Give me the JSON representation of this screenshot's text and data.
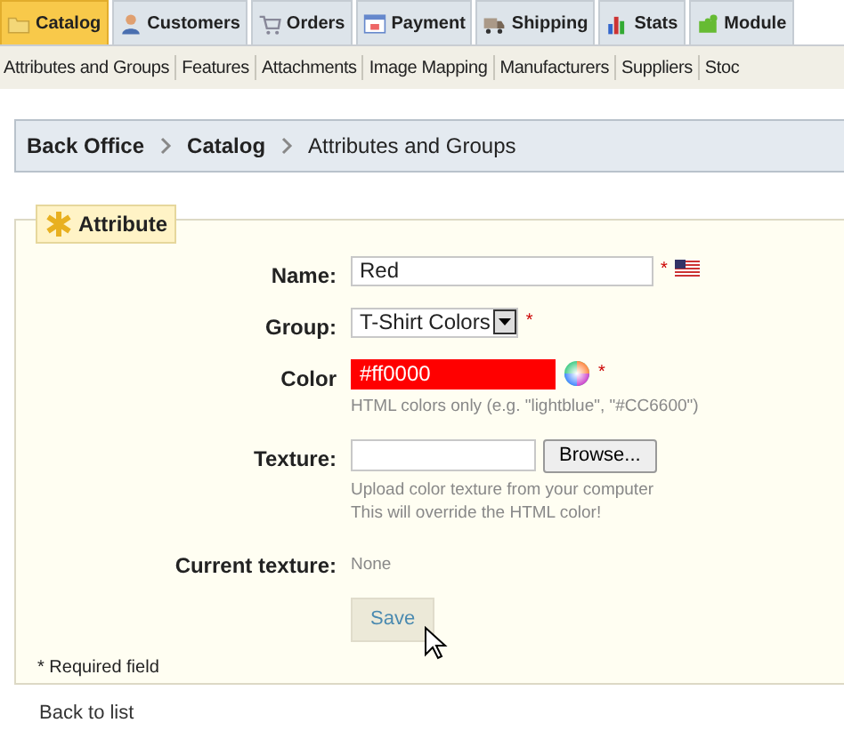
{
  "tabs": [
    {
      "label": "Catalog",
      "selected": true
    },
    {
      "label": "Customers",
      "selected": false
    },
    {
      "label": "Orders",
      "selected": false
    },
    {
      "label": "Payment",
      "selected": false
    },
    {
      "label": "Shipping",
      "selected": false
    },
    {
      "label": "Stats",
      "selected": false
    },
    {
      "label": "Module",
      "selected": false
    }
  ],
  "subnav": [
    "Attributes and Groups",
    "Features",
    "Attachments",
    "Image Mapping",
    "Manufacturers",
    "Suppliers",
    "Stoc"
  ],
  "breadcrumb": [
    "Back Office",
    "Catalog",
    "Attributes and Groups"
  ],
  "form": {
    "legend": "Attribute",
    "fields": [
      {
        "kind": "text",
        "label": "Name:",
        "value": "Red",
        "required_mark": "*"
      },
      {
        "kind": "select",
        "label": "Group:",
        "value": "T-Shirt Colors",
        "required_mark": "*"
      },
      {
        "kind": "color",
        "label": "Color",
        "value": "#ff0000",
        "color": "#ff0000",
        "required_mark": "*",
        "hint": [
          "HTML colors only (e.g. \"lightblue\", \"#CC6600\")"
        ]
      },
      {
        "kind": "file",
        "label": "Texture:",
        "button": "Browse...",
        "hint": [
          "Upload color texture from your computer",
          "This will override the HTML color!"
        ]
      },
      {
        "kind": "static",
        "label": "Current texture:",
        "value": "None"
      }
    ],
    "save_button": "Save",
    "footnote": "* Required field"
  },
  "back_link": "Back to list"
}
